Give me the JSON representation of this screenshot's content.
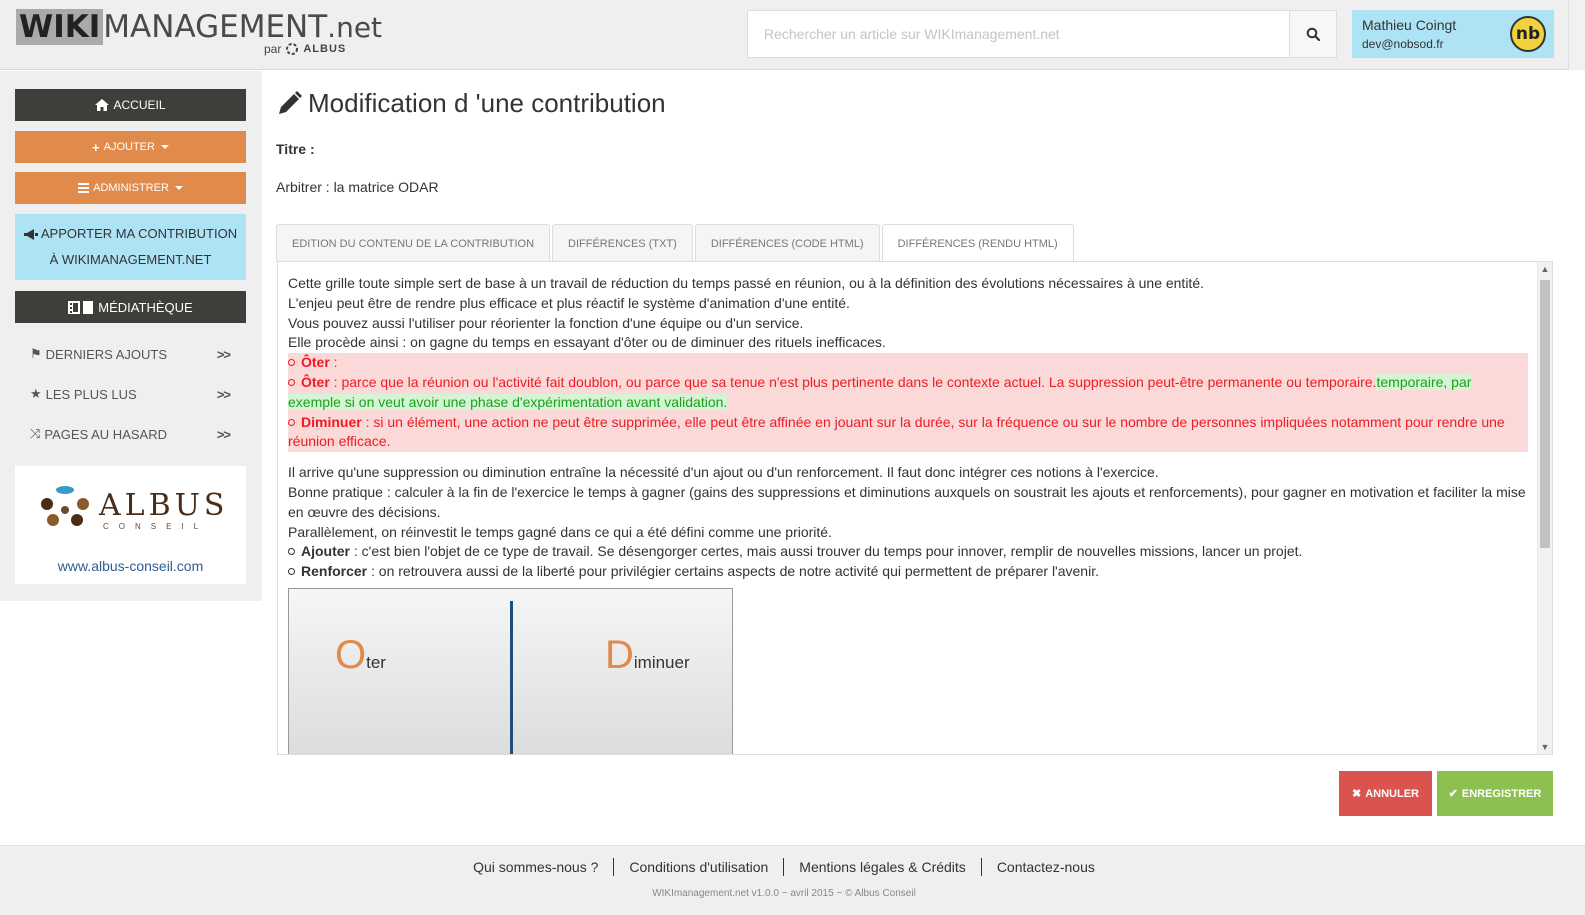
{
  "header": {
    "logo_wiki": "WIKI",
    "logo_management": "MANAGEMENT",
    "logo_net": ".net",
    "logo_par": "par",
    "logo_albus": "ALBUS",
    "search_placeholder": "Rechercher un article sur WIKImanagement.net",
    "user_name": "Mathieu Coingt",
    "user_email": "dev@nobsod.fr",
    "avatar_text": "nb"
  },
  "sidebar": {
    "accueil": "ACCUEIL",
    "ajouter": "AJOUTER",
    "administrer": "ADMINISTRER",
    "contrib_line1": "APPORTER MA CONTRIBUTION",
    "contrib_line2": "À WIKIMANAGEMENT.NET",
    "mediatheque": "MÉDIATHÈQUE",
    "links": [
      "DERNIERS AJOUTS",
      "LES PLUS LUS",
      "PAGES AU HASARD"
    ],
    "chevron": ">>",
    "albus_name": "ALBUS",
    "albus_sub": "CONSEIL",
    "albus_url": "www.albus-conseil.com"
  },
  "main": {
    "page_title": "Modification d 'une contribution",
    "title_label": "Titre :",
    "title_value": "Arbitrer : la matrice ODAR",
    "tabs": [
      "EDITION DU CONTENU DE LA CONTRIBUTION",
      "DIFFÉRENCES (TXT)",
      "DIFFÉRENCES (CODE HTML)",
      "DIFFÉRENCES (RENDU HTML)"
    ],
    "active_tab": 3
  },
  "content": {
    "p1": "Cette grille toute simple sert de base à un travail de réduction du temps passé en réunion, ou à la définition des évolutions nécessaires à une entité.",
    "p2": "L'enjeu peut être de rendre plus efficace et plus réactif le système d'animation d'une entité.",
    "p3": "Vous pouvez aussi l'utiliser pour réorienter la fonction d'une équipe ou d'un service.",
    "p4": "Elle procède ainsi : on gagne du temps en essayant d'ôter ou de diminuer des rituels inefficaces.",
    "del1_term": "Ôter",
    "del1_text": " :",
    "del2_term": "Ôter",
    "del2_text": " : parce que la réunion ou l'activité fait doublon, ou parce que sa tenue n'est plus pertinente dans le contexte actuel. La suppression peut-être permanente ou temporaire.",
    "ins1": "temporaire, par exemple si on veut avoir une phase d'expérimentation avant validation.",
    "del3_term": "Diminuer",
    "del3_text": " : si un élément, une action ne peut être supprimée, elle peut être affinée en jouant sur la durée, sur la fréquence ou sur le nombre de personnes impliquées notamment pour rendre une réunion efficace.",
    "p5": "Il arrive qu'une suppression ou diminution entraîne la nécessité d'un ajout ou d'un renforcement. Il faut donc intégrer ces notions à l'exercice.",
    "p6": "Bonne pratique : calculer à la fin de l'exercice le temps à gagner (gains des suppressions et diminutions auxquels on soustrait les ajouts et renforcements), pour gagner en motivation et faciliter la mise en œuvre des décisions.",
    "p7": "Parallèlement, on réinvestit le temps gagné dans ce qui a été défini comme une priorité.",
    "b1_term": "Ajouter",
    "b1_text": " : c'est bien l'objet de ce type de travail. Se désengorger certes, mais aussi trouver du temps pour innover, remplir de nouvelles missions, lancer un projet.",
    "b2_term": "Renforcer",
    "b2_text": " : on retrouvera aussi de la liberté pour privilégier certains aspects de notre activité qui permettent de préparer l'avenir.",
    "odar_o": "O",
    "odar_o_rest": "ter",
    "odar_d": "D",
    "odar_d_rest": "iminuer"
  },
  "actions": {
    "cancel": "ANNULER",
    "save": "ENREGISTRER"
  },
  "footer": {
    "links": [
      "Qui sommes-nous ?",
      "Conditions d'utilisation",
      "Mentions légales & Crédits",
      "Contactez-nous"
    ],
    "copyright": "WIKImanagement.net v1.0.0 ~ avril 2015 ~ © Albus Conseil"
  }
}
